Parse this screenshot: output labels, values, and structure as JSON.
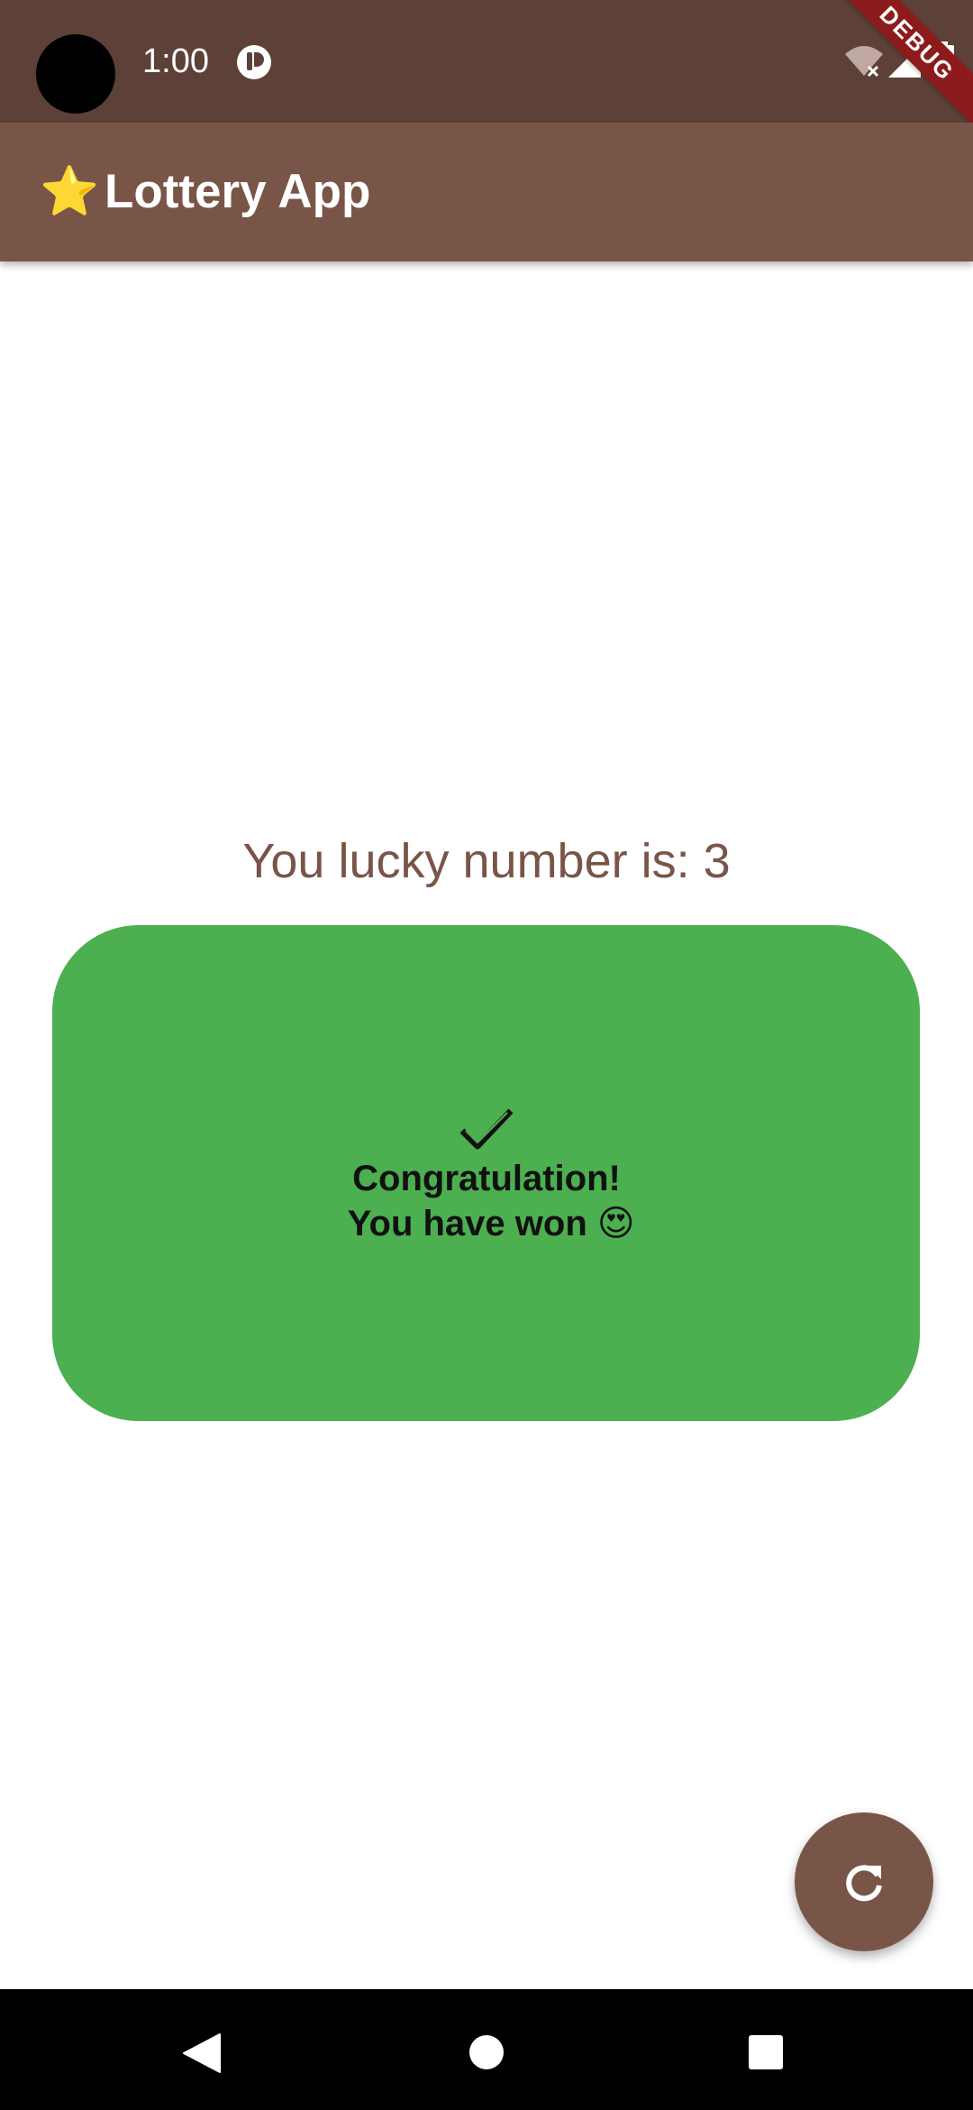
{
  "status_bar": {
    "time": "1:00",
    "debug_banner": "DEBUG",
    "icons": [
      "camera-cutout",
      "app-notification-icon",
      "wifi-off-icon",
      "signal-icon",
      "battery-icon"
    ]
  },
  "app_bar": {
    "title_icon": "⭐",
    "title": "Lottery App",
    "background": "#795548"
  },
  "main": {
    "lucky_number_text": "You lucky number is: 3",
    "result_card": {
      "icon": "check-icon",
      "message": "Congratulation!\n You have won 😍",
      "background": "#4caf50"
    }
  },
  "fab": {
    "icon": "refresh-icon",
    "background": "#795548"
  },
  "nav_bar": {
    "icons": [
      "back-icon",
      "home-icon",
      "recents-icon"
    ]
  },
  "colors": {
    "status_bar": "#5d4037",
    "primary": "#795548",
    "success": "#4caf50"
  }
}
